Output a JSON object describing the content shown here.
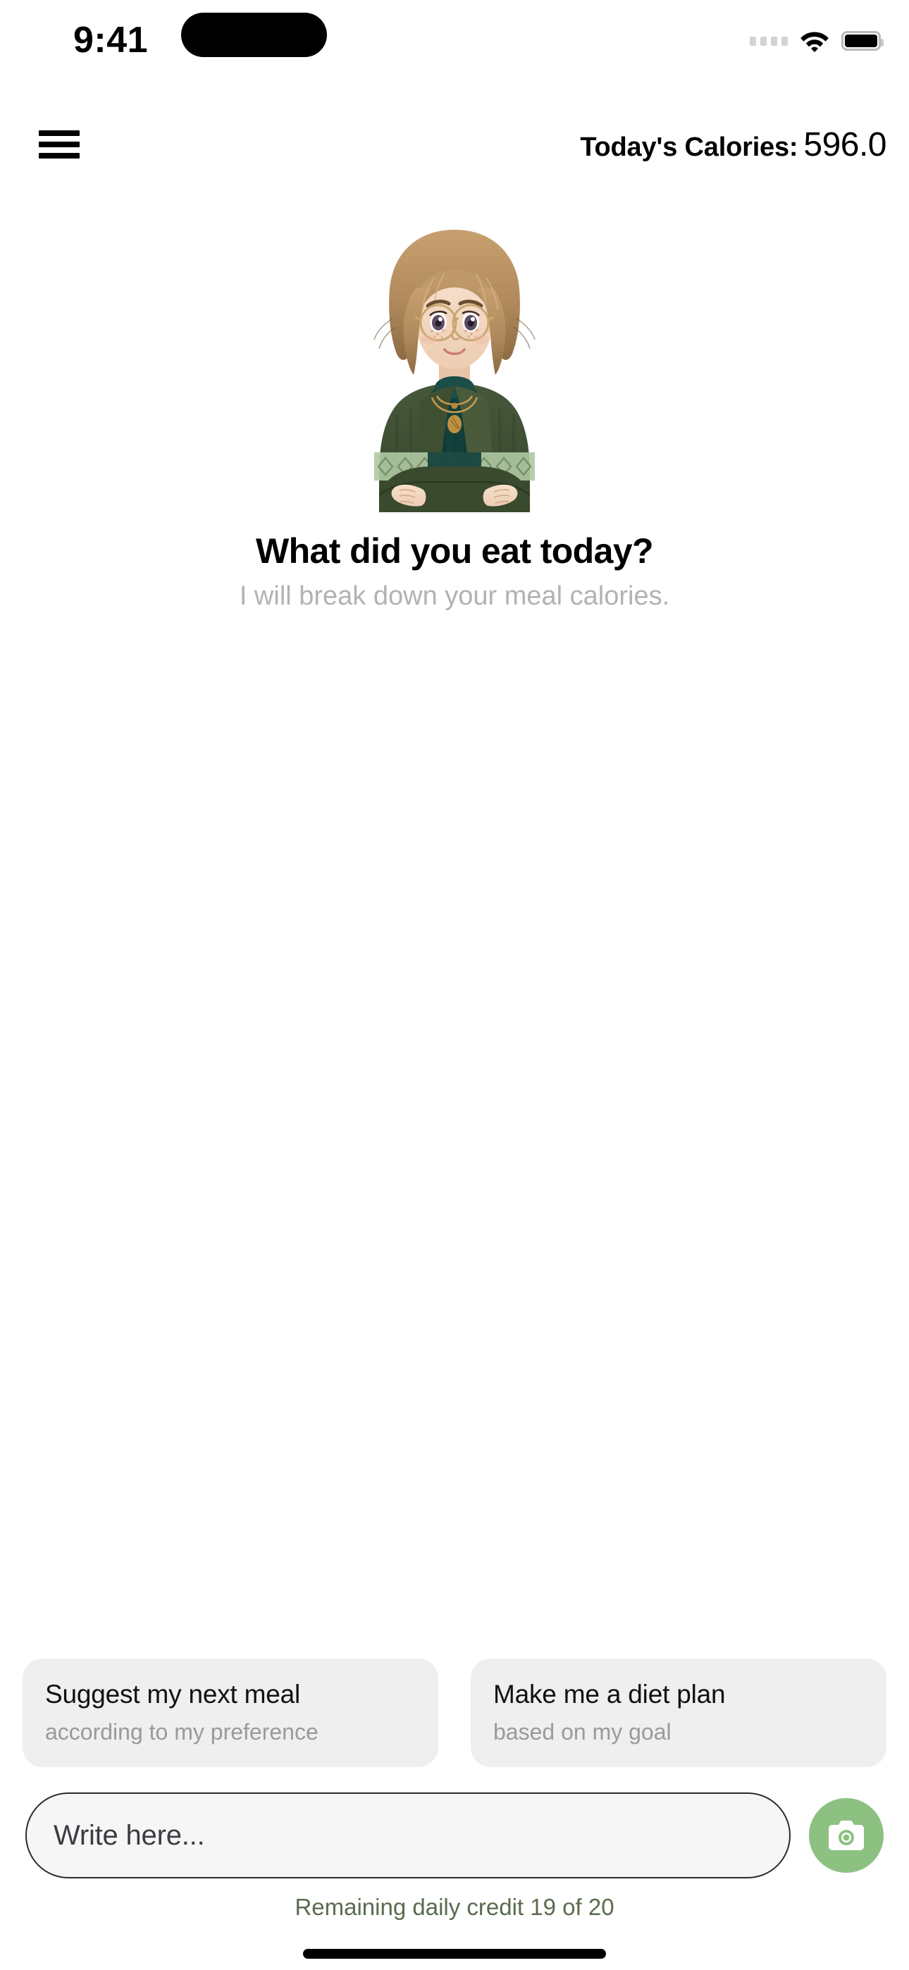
{
  "status_bar": {
    "time": "9:41",
    "cellular_icon": "cellular-dots-icon",
    "wifi_icon": "wifi-icon",
    "battery_icon": "battery-full-icon"
  },
  "header": {
    "menu_icon": "hamburger-menu-icon",
    "calories_label": "Today's Calories:",
    "calories_value": "596.0"
  },
  "hero": {
    "avatar_name": "nutritionist-avatar",
    "title": "What did you eat today?",
    "subtitle": "I will break down your meal calories."
  },
  "suggestions": [
    {
      "title": "Suggest my next meal",
      "subtitle": "according to my preference"
    },
    {
      "title": "Make me a diet plan",
      "subtitle": "based on my goal"
    }
  ],
  "composer": {
    "placeholder": "Write here...",
    "value": "",
    "camera_icon": "camera-icon"
  },
  "footer": {
    "credit_text": "Remaining daily credit 19 of 20"
  },
  "colors": {
    "accent_green": "#8CC182",
    "credit_green": "#5A6B4E",
    "chip_background": "#EFEFEF",
    "composer_background": "#F6F6F6",
    "muted_text": "#B2B2B2"
  }
}
